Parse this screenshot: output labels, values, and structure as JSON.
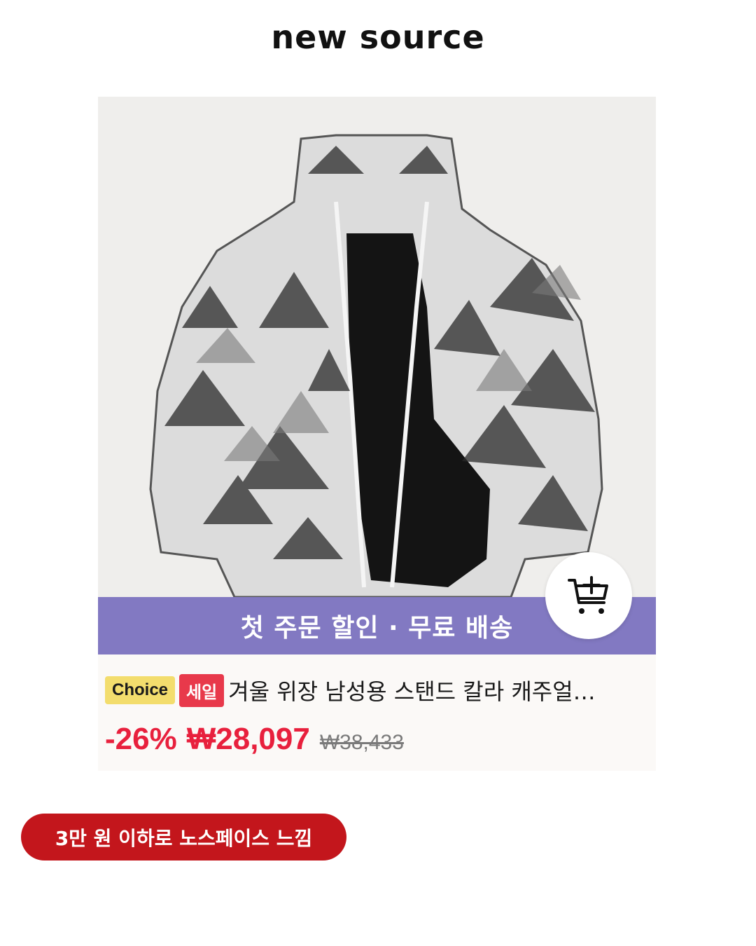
{
  "brand": {
    "logo_text": "new source"
  },
  "product": {
    "image_alt": "snow mountain print padded jacket",
    "promo_banner": "첫 주문 할인 · 무료 배송",
    "badges": {
      "choice": "Choice",
      "sale": "세일"
    },
    "title": "겨울 위장 남성용 스탠드 칼라 캐주얼…",
    "discount": "-26%",
    "price": "₩28,097",
    "original_price": "₩38,433",
    "cart_icon": "add-to-cart-icon"
  },
  "caption": {
    "text": "3만 원 이하로 노스페이스 느낌"
  },
  "colors": {
    "promo_banner_bg": "#8279c2",
    "sale_red": "#e8203d",
    "choice_yellow": "#f3dd6d",
    "caption_bg": "#c3161c"
  }
}
